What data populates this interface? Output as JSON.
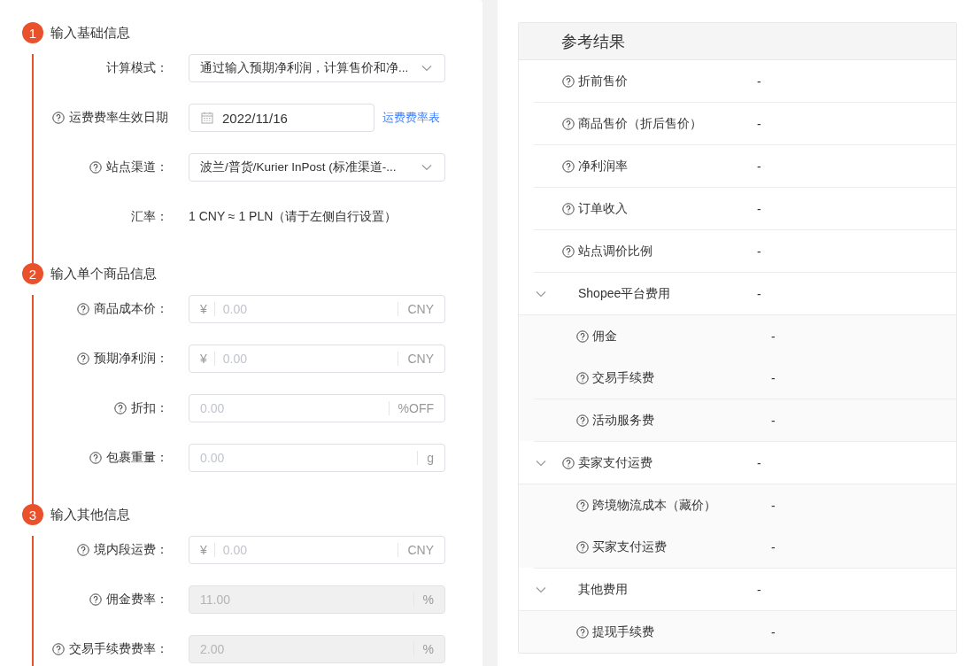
{
  "steps": [
    {
      "number": "1",
      "title": "输入基础信息",
      "fields": [
        {
          "kind": "select",
          "label": "计算模式：",
          "help": false,
          "value": "通过输入预期净利润，计算售价和净..."
        },
        {
          "kind": "date",
          "label": "运费费率生效日期",
          "help": true,
          "value": "2022/11/16",
          "link": "运费费率表"
        },
        {
          "kind": "select",
          "label": "站点渠道：",
          "help": true,
          "value": "波兰/普货/Kurier InPost (标准渠道-..."
        },
        {
          "kind": "static",
          "label": "汇率：",
          "help": false,
          "value": "1 CNY ≈ 1 PLN（请于左侧自行设置）"
        }
      ]
    },
    {
      "number": "2",
      "title": "输入单个商品信息",
      "fields": [
        {
          "kind": "input",
          "label": "商品成本价：",
          "help": true,
          "prefix": "¥",
          "placeholder": "0.00",
          "suffix": "CNY",
          "disabled": false
        },
        {
          "kind": "input",
          "label": "预期净利润：",
          "help": true,
          "prefix": "¥",
          "placeholder": "0.00",
          "suffix": "CNY",
          "disabled": false
        },
        {
          "kind": "input",
          "label": "折扣：",
          "help": true,
          "placeholder": "0.00",
          "suffix": "%OFF",
          "disabled": false
        },
        {
          "kind": "input",
          "label": "包裹重量：",
          "help": true,
          "placeholder": "0.00",
          "suffix": "g",
          "disabled": false
        }
      ]
    },
    {
      "number": "3",
      "title": "输入其他信息",
      "fields": [
        {
          "kind": "input",
          "label": "境内段运费：",
          "help": true,
          "prefix": "¥",
          "placeholder": "0.00",
          "suffix": "CNY",
          "disabled": false
        },
        {
          "kind": "input",
          "label": "佣金费率：",
          "help": true,
          "placeholder": "11.00",
          "suffix": "%",
          "disabled": true
        },
        {
          "kind": "input",
          "label": "交易手续费费率：",
          "help": true,
          "placeholder": "2.00",
          "suffix": "%",
          "disabled": true
        }
      ]
    }
  ],
  "results": {
    "title": "参考结果",
    "rows": [
      {
        "label": "折前售价",
        "help": true,
        "value": "-"
      },
      {
        "label": "商品售价（折后售价）",
        "help": true,
        "value": "-"
      },
      {
        "label": "净利润率",
        "help": true,
        "value": "-"
      },
      {
        "label": "订单收入",
        "help": true,
        "value": "-"
      },
      {
        "label": "站点调价比例",
        "help": true,
        "value": "-"
      },
      {
        "label": "Shopee平台费用",
        "help": false,
        "value": "-",
        "expanded": true,
        "children": [
          {
            "label": "佣金",
            "help": true,
            "value": "-"
          },
          {
            "label": "交易手续费",
            "help": true,
            "value": "-"
          },
          {
            "label": "活动服务费",
            "help": true,
            "value": "-"
          }
        ]
      },
      {
        "label": "卖家支付运费",
        "help": true,
        "value": "-",
        "expanded": true,
        "children": [
          {
            "label": "跨境物流成本（藏价）",
            "help": true,
            "value": "-"
          },
          {
            "label": "买家支付运费",
            "help": true,
            "value": "-"
          }
        ]
      },
      {
        "label": "其他费用",
        "help": false,
        "value": "-",
        "expanded": true,
        "children": [
          {
            "label": "提现手续费",
            "help": true,
            "value": "-"
          }
        ]
      }
    ]
  }
}
